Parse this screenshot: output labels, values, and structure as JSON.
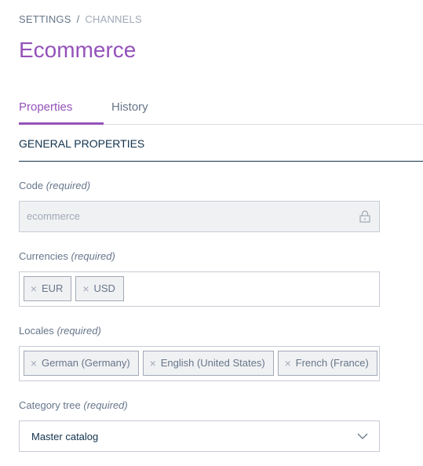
{
  "breadcrumb": {
    "root": "SETTINGS",
    "separator": "/",
    "current": "CHANNELS"
  },
  "page_title": "Ecommerce",
  "tabs": [
    {
      "label": "Properties",
      "active": true
    },
    {
      "label": "History",
      "active": false
    }
  ],
  "section": {
    "title": "GENERAL PROPERTIES"
  },
  "fields": {
    "code": {
      "label": "Code",
      "required": "(required)",
      "value": "ecommerce",
      "icon": "lock-icon"
    },
    "currencies": {
      "label": "Currencies",
      "required": "(required)",
      "chips": [
        "EUR",
        "USD"
      ],
      "remove_symbol": "×"
    },
    "locales": {
      "label": "Locales",
      "required": "(required)",
      "chips": [
        "German (Germany)",
        "English (United States)",
        "French (France)"
      ],
      "remove_symbol": "×"
    },
    "category_tree": {
      "label": "Category tree",
      "required": "(required)",
      "value": "Master catalog",
      "icon": "chevron-down-icon"
    }
  },
  "colors": {
    "accent": "#9452ba",
    "text_dark": "#11324d",
    "text_muted": "#67768a",
    "border": "#c7cbd4",
    "readonly_bg": "#f0f1f3"
  }
}
